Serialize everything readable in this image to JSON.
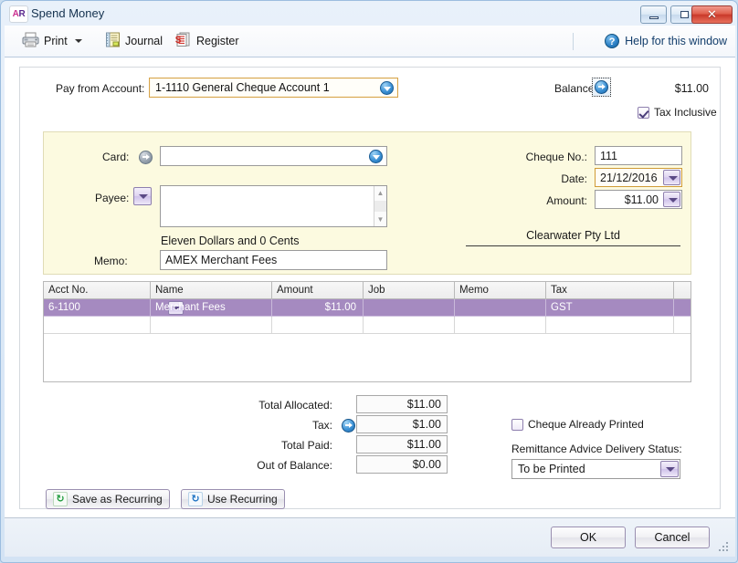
{
  "window": {
    "title": "Spend Money",
    "app_icon_a": "A",
    "app_icon_r": "R",
    "minimize_label": "Minimize",
    "maximize_label": "Maximize",
    "close_label": "✕"
  },
  "toolbar": {
    "print_label": "Print",
    "journal_label": "Journal",
    "register_label": "Register",
    "help_label": "Help for this window",
    "help_glyph": "?"
  },
  "header": {
    "pay_from_label": "Pay from Account:",
    "pay_from_value": "1-1110 General Cheque Account 1",
    "balance_label": "Balance:",
    "balance_value": "$11.00",
    "tax_inclusive_label": "Tax Inclusive",
    "tax_inclusive_checked": true
  },
  "cheque": {
    "card_label": "Card:",
    "card_value": "",
    "payee_label": "Payee:",
    "payee_value": "",
    "amount_in_words": "Eleven Dollars and 0 Cents",
    "memo_label": "Memo:",
    "memo_value": "AMEX Merchant Fees",
    "cheque_no_label": "Cheque No.:",
    "cheque_no_value": "111",
    "date_label": "Date:",
    "date_value": "21/12/2016",
    "amount_label": "Amount:",
    "amount_value": "$11.00",
    "company_name": "Clearwater Pty Ltd"
  },
  "grid": {
    "columns": [
      "Acct No.",
      "Name",
      "Amount",
      "Job",
      "Memo",
      "Tax",
      ""
    ],
    "rows": [
      {
        "acct_no": "6-1100",
        "name": "Merchant Fees",
        "amount": "$11.00",
        "job": "",
        "memo": "",
        "tax": "GST",
        "extra": "",
        "selected": true
      },
      {
        "acct_no": "",
        "name": "",
        "amount": "",
        "job": "",
        "memo": "",
        "tax": "",
        "extra": "",
        "selected": false
      }
    ]
  },
  "totals": {
    "total_allocated_label": "Total Allocated:",
    "total_allocated_value": "$11.00",
    "tax_label": "Tax:",
    "tax_value": "$1.00",
    "total_paid_label": "Total Paid:",
    "total_paid_value": "$11.00",
    "out_of_balance_label": "Out of Balance:",
    "out_of_balance_value": "$0.00"
  },
  "options": {
    "cheque_printed_label": "Cheque Already Printed",
    "cheque_printed_checked": false,
    "remittance_label": "Remittance Advice Delivery Status:",
    "remittance_value": "To be Printed"
  },
  "recurring": {
    "save_label": "Save as Recurring",
    "save_icon_glyph": "↻",
    "use_label": "Use Recurring",
    "use_icon_glyph": "↻"
  },
  "footer": {
    "ok_label": "OK",
    "cancel_label": "Cancel"
  }
}
